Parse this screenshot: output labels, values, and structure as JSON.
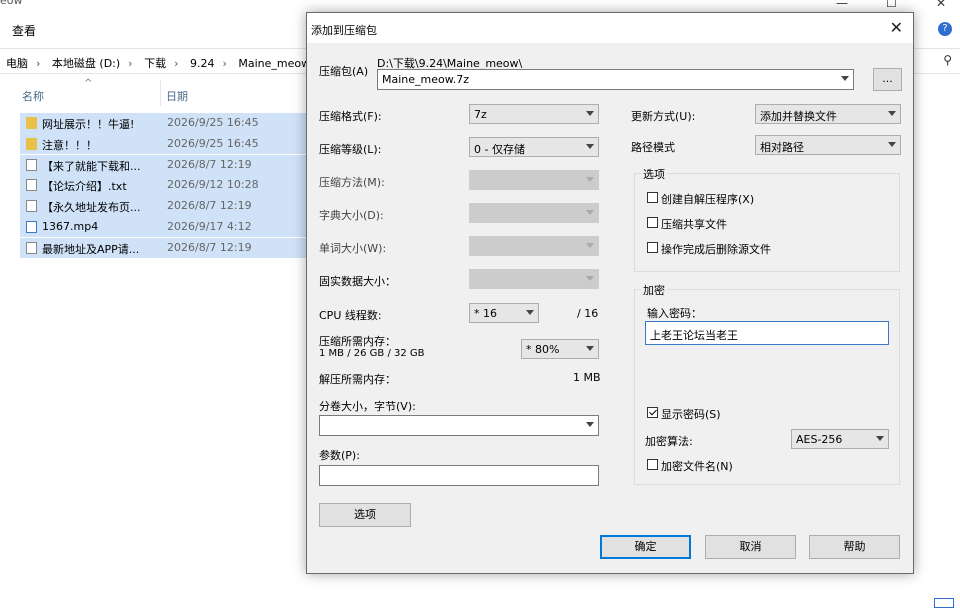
{
  "explorer": {
    "title_fragment": "eow",
    "ribbon_tab": "查看",
    "breadcrumb": [
      "电脑",
      "本地磁盘 (D:)",
      "下载",
      "9.24",
      "Maine_meow"
    ],
    "columns": {
      "name": "名称",
      "date": "日期"
    },
    "files": [
      {
        "icon": "folder",
        "name": "网址展示！！牛逼!",
        "date": "2026/9/25 16:45"
      },
      {
        "icon": "folder",
        "name": "注意！！！",
        "date": "2026/9/25 16:45"
      },
      {
        "icon": "doc",
        "name": "【来了就能下载和...",
        "date": "2026/8/7 12:19"
      },
      {
        "icon": "doc",
        "name": "【论坛介绍】.txt",
        "date": "2026/9/12 10:28"
      },
      {
        "icon": "doc",
        "name": "【永久地址发布页...",
        "date": "2026/8/7 12:19"
      },
      {
        "icon": "video",
        "name": "1367.mp4",
        "date": "2026/9/17 4:12"
      },
      {
        "icon": "doc",
        "name": "最新地址及APP请...",
        "date": "2026/8/7 12:19"
      }
    ]
  },
  "dialog": {
    "title": "添加到压缩包",
    "archive_label": "压缩包(A)",
    "archive_path": "D:\\下载\\9.24\\Maine_meow\\",
    "archive_name": "Maine_meow.7z",
    "browse_label": "...",
    "format_label": "压缩格式(F):",
    "format_value": "7z",
    "level_label": "压缩等级(L):",
    "level_value": "0 - 仅存储",
    "method_label": "压缩方法(M):",
    "dict_label": "字典大小(D):",
    "word_label": "单词大小(W):",
    "solid_label": "固实数据大小：",
    "cpu_label": "CPU 线程数:",
    "cpu_value": "* 16",
    "cpu_total": "/ 16",
    "mem_label": "压缩所需内存：",
    "mem_detail": "1 MB / 26 GB / 32 GB",
    "mem_value": "* 80%",
    "decomp_label": "解压所需内存：",
    "decomp_value": "1 MB",
    "split_label": "分卷大小，字节(V):",
    "params_label": "参数(P):",
    "options_button": "选项",
    "update_label": "更新方式(U):",
    "update_value": "添加并替换文件",
    "path_label": "路径模式",
    "path_value": "相对路径",
    "options_group": "选项",
    "opt_sfx": "创建自解压程序(X)",
    "opt_shared": "压缩共享文件",
    "opt_delete": "操作完成后删除源文件",
    "encrypt_group": "加密",
    "password_label": "输入密码：",
    "password_value": "上老王论坛当老王",
    "show_password": "显示密码(S)",
    "encrypt_method_label": "加密算法:",
    "encrypt_method_value": "AES-256",
    "encrypt_names": "加密文件名(N)",
    "ok": "确定",
    "cancel": "取消",
    "help": "帮助"
  }
}
